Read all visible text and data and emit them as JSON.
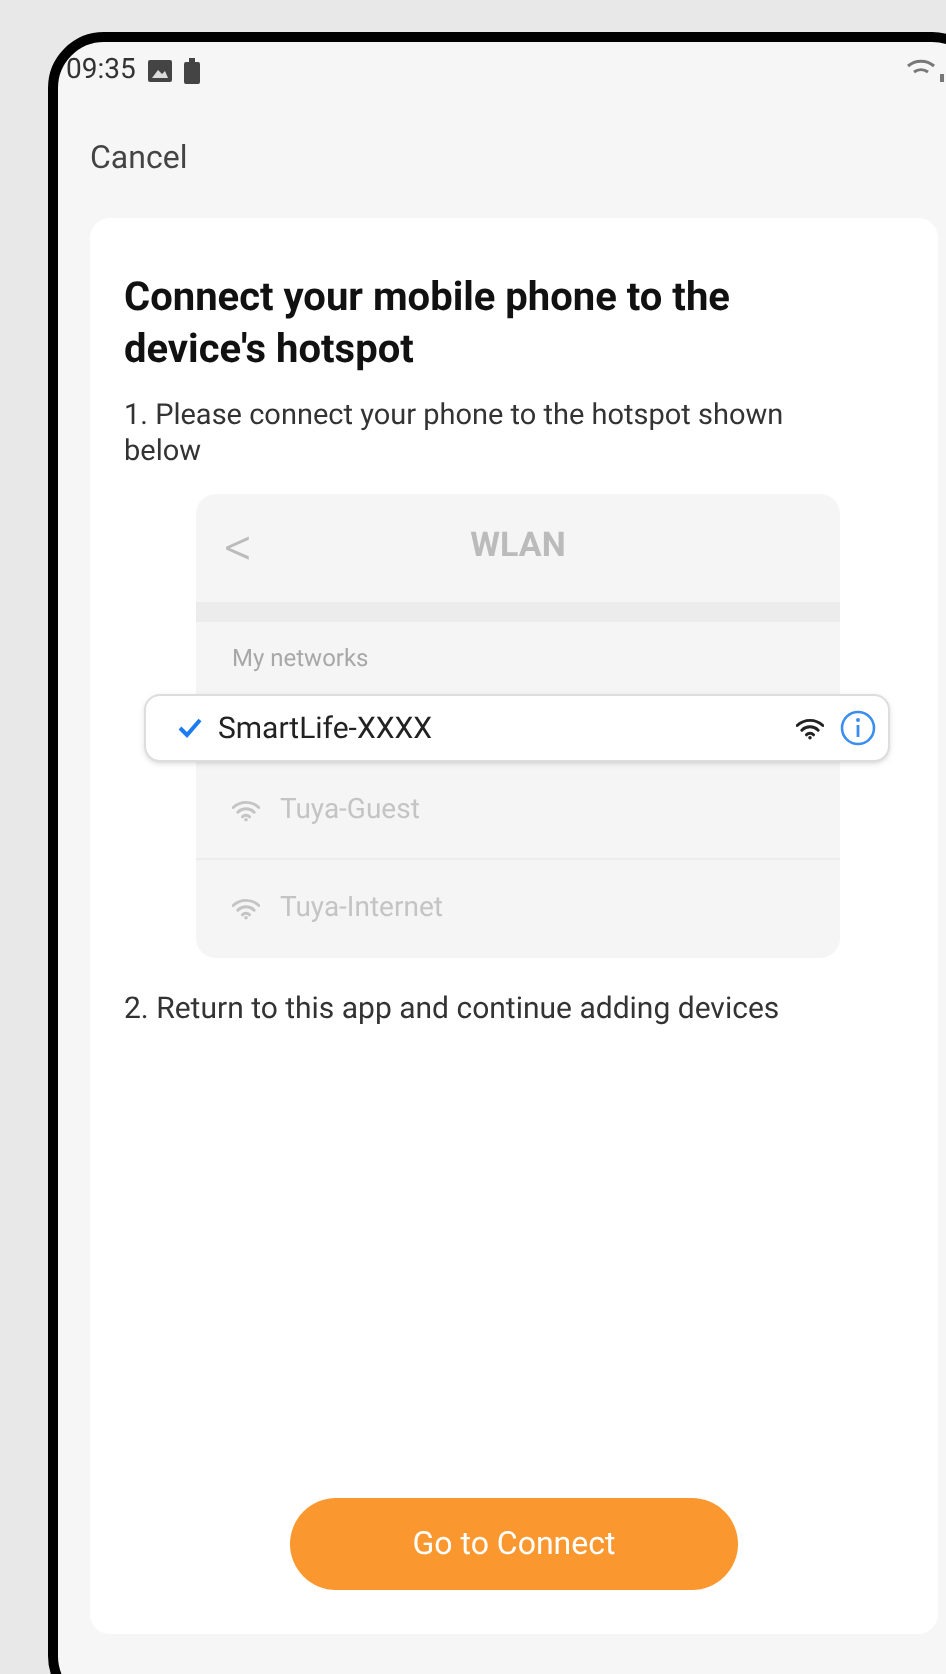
{
  "status_bar": {
    "time": "09:35"
  },
  "nav": {
    "cancel": "Cancel"
  },
  "card": {
    "title": "Connect your mobile phone to the device's hotspot",
    "step_1": "1. Please connect your phone to the hotspot shown below",
    "illustration": {
      "back": "<",
      "title": "WLAN",
      "section": "My networks",
      "networks": [
        {
          "name": "SmartLife-XXXX",
          "selected": true
        },
        {
          "name": "Tuya-Guest",
          "selected": false
        },
        {
          "name": "Tuya-Internet",
          "selected": false
        }
      ]
    },
    "step_2": "2. Return to this app and continue adding devices",
    "button": "Go to Connect"
  }
}
